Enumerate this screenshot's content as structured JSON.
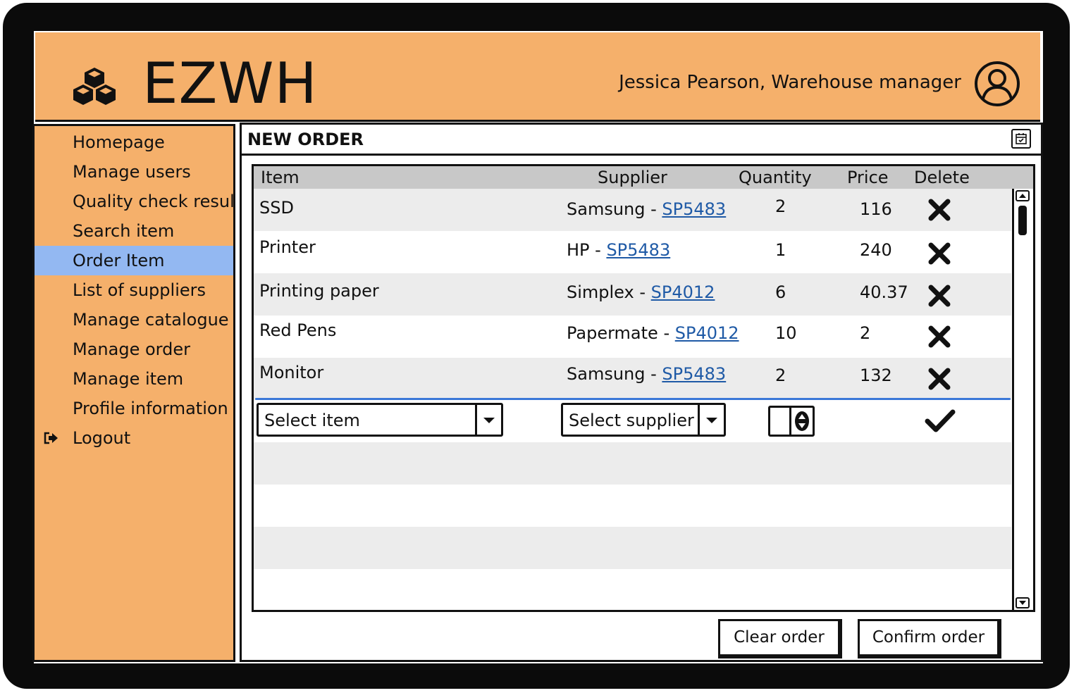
{
  "app": {
    "title": "EZWH",
    "user": "Jessica Pearson, Warehouse manager",
    "logo_icon": "boxes-icon",
    "avatar_icon": "user-avatar-icon",
    "colors": {
      "header": "#f5b06b",
      "active_nav": "#93b8f2",
      "link": "#1f5aa6",
      "row_alt": "#ececec",
      "table_header": "#c8c8c8"
    }
  },
  "sidebar": {
    "items": [
      {
        "label": "Homepage"
      },
      {
        "label": "Manage users"
      },
      {
        "label": "Quality check results"
      },
      {
        "label": "Search item"
      },
      {
        "label": "Order Item",
        "active": true
      },
      {
        "label": "List of suppliers"
      },
      {
        "label": "Manage catalogue"
      },
      {
        "label": "Manage order"
      },
      {
        "label": "Manage item"
      },
      {
        "label": "Profile information"
      },
      {
        "label": "Logout",
        "icon": "logout-icon"
      }
    ]
  },
  "panel": {
    "title": "NEW ORDER",
    "icon": "calendar-icon"
  },
  "table": {
    "columns": [
      "Item",
      "Supplier",
      "Quantity",
      "Price",
      "Delete"
    ],
    "rows": [
      {
        "item": "SSD",
        "supplier": "Samsung - ",
        "code": "SP5483",
        "quantity": "2",
        "price": "116"
      },
      {
        "item": "Printer",
        "supplier": "HP - ",
        "code": "SP5483",
        "quantity": "1",
        "price": "240"
      },
      {
        "item": "Printing paper",
        "supplier": "Simplex - ",
        "code": "SP4012",
        "quantity": "6",
        "price": "40.37"
      },
      {
        "item": "Red Pens",
        "supplier": "Papermate - ",
        "code": "SP4012",
        "quantity": "10",
        "price": "2"
      },
      {
        "item": "Monitor",
        "supplier": "Samsung - ",
        "code": "SP5483",
        "quantity": "2",
        "price": "132"
      }
    ],
    "new_row": {
      "item_placeholder": "Select item",
      "supplier_placeholder": "Select supplier"
    }
  },
  "buttons": {
    "clear": "Clear order",
    "confirm": "Confirm order"
  }
}
